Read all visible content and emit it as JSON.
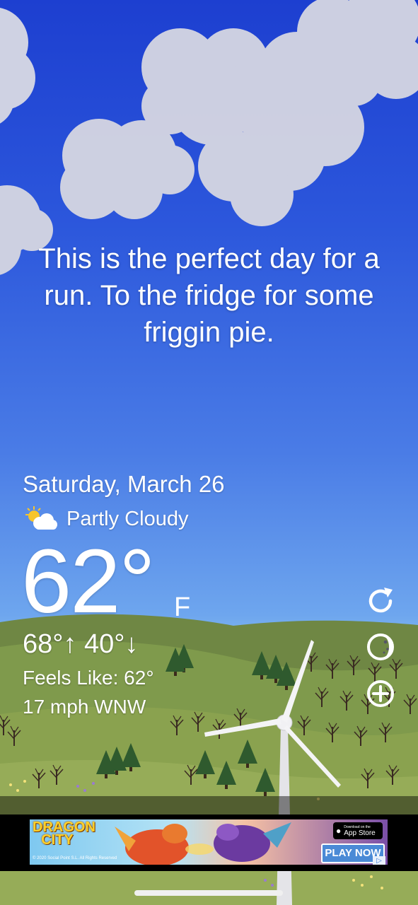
{
  "message": "This is the perfect day for a run. To the fridge for some friggin pie.",
  "date": "Saturday, March 26",
  "condition": {
    "label": "Partly Cloudy",
    "icon": "partly-cloudy-icon"
  },
  "temperature": {
    "value": "62°",
    "unit": "F"
  },
  "hilo": {
    "high": "68°",
    "high_arrow": "↑",
    "low": "40°",
    "low_arrow": "↓"
  },
  "feels_like": "Feels Like: 62°",
  "wind": "17 mph WNW",
  "actions": [
    {
      "name": "refresh-icon"
    },
    {
      "name": "moon-icon"
    },
    {
      "name": "add-icon"
    }
  ],
  "ad": {
    "logo_line1": "DRAGON",
    "logo_line2": "CITY",
    "copyright": "© 2020 Social Point S.L. All Rights Reserved",
    "store_small": "Download on the",
    "store_big": "App Store",
    "cta": "PLAY NOW",
    "adchoices_glyph": "▷"
  },
  "colors": {
    "sky_top": "#1d3fd0",
    "sky_bottom": "#88c0f2",
    "hills": "#7f9a4c",
    "ad_bar": "#000000"
  }
}
